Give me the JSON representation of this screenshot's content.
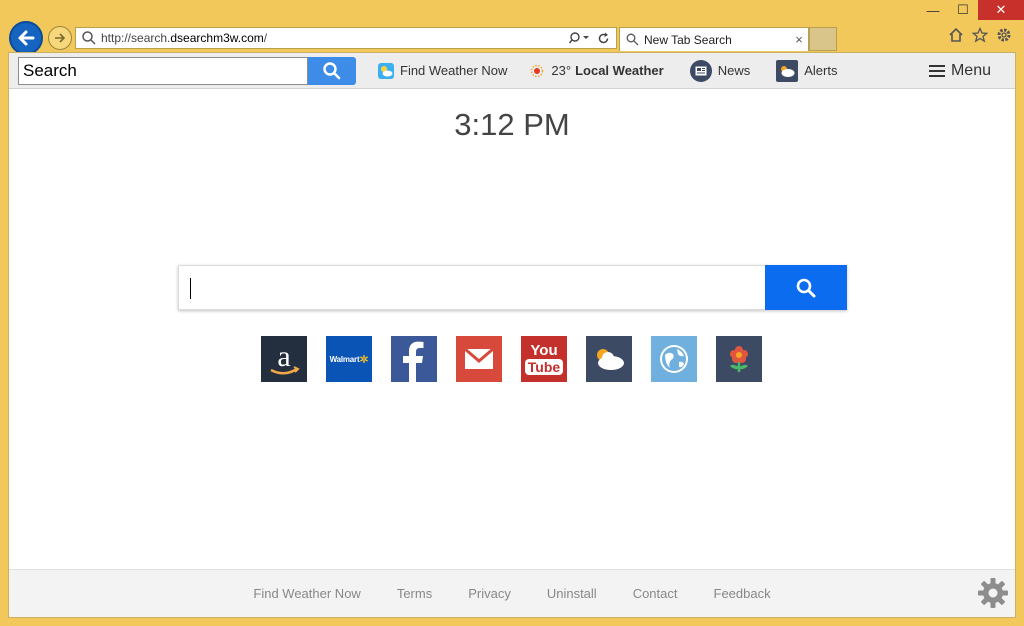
{
  "browser": {
    "url_prefix": "http://search.",
    "url_domain": "dsearchm3w.com",
    "url_suffix": "/",
    "tab_title": "New Tab Search",
    "tab_close": "×",
    "minimize": "—",
    "maximize": "☐",
    "close": "✕"
  },
  "toolbar": {
    "search_value": "Search",
    "weather_link": "Find Weather Now",
    "temperature": "23°",
    "local_weather": "Local Weather",
    "news": "News",
    "alerts": "Alerts",
    "menu": "Menu"
  },
  "main": {
    "time": "3:12 PM",
    "search_placeholder": ""
  },
  "quick_links": {
    "walmart_label": "Walmart",
    "youtube_top": "You",
    "youtube_bottom": "Tube"
  },
  "footer": {
    "links": [
      "Find Weather Now",
      "Terms",
      "Privacy",
      "Uninstall",
      "Contact",
      "Feedback"
    ]
  },
  "colors": {
    "frame": "#f3c85b",
    "toolbar_button": "#3d8de8",
    "main_button": "#0c6cf0",
    "amazon": "#232f3e",
    "walmart": "#0a54b5",
    "facebook": "#3b5998",
    "gmail": "#d7493b",
    "youtube": "#c4302b"
  }
}
